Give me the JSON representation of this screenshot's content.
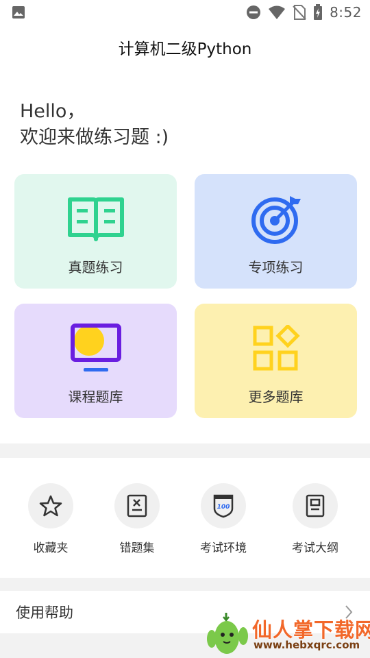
{
  "status_bar": {
    "time": "8:52"
  },
  "app_bar": {
    "title": "计算机二级Python"
  },
  "greeting": {
    "line1": "Hello，",
    "line2": "欢迎来做练习题 :)"
  },
  "cards": [
    {
      "label": "真题练习",
      "icon": "open-book-icon",
      "bg": "#e1f7ee"
    },
    {
      "label": "专项练习",
      "icon": "target-icon",
      "bg": "#d5e2fb"
    },
    {
      "label": "课程题库",
      "icon": "monitor-icon",
      "bg": "#e6dbfc"
    },
    {
      "label": "更多题库",
      "icon": "grid-icon",
      "bg": "#fdf0b0"
    }
  ],
  "shortcuts": [
    {
      "label": "收藏夹",
      "icon": "star-icon"
    },
    {
      "label": "错题集",
      "icon": "wrong-doc-icon"
    },
    {
      "label": "考试环境",
      "icon": "exam-badge-icon"
    },
    {
      "label": "考试大纲",
      "icon": "outline-doc-icon"
    }
  ],
  "help": {
    "label": "使用帮助"
  },
  "watermark": {
    "title": "仙人掌下载网",
    "url": "www.hebxqrc.com"
  },
  "colors": {
    "green": "#2fd28f",
    "blue": "#2f6bf0",
    "purple": "#6a1ee0",
    "yellow": "#ffd21e"
  }
}
